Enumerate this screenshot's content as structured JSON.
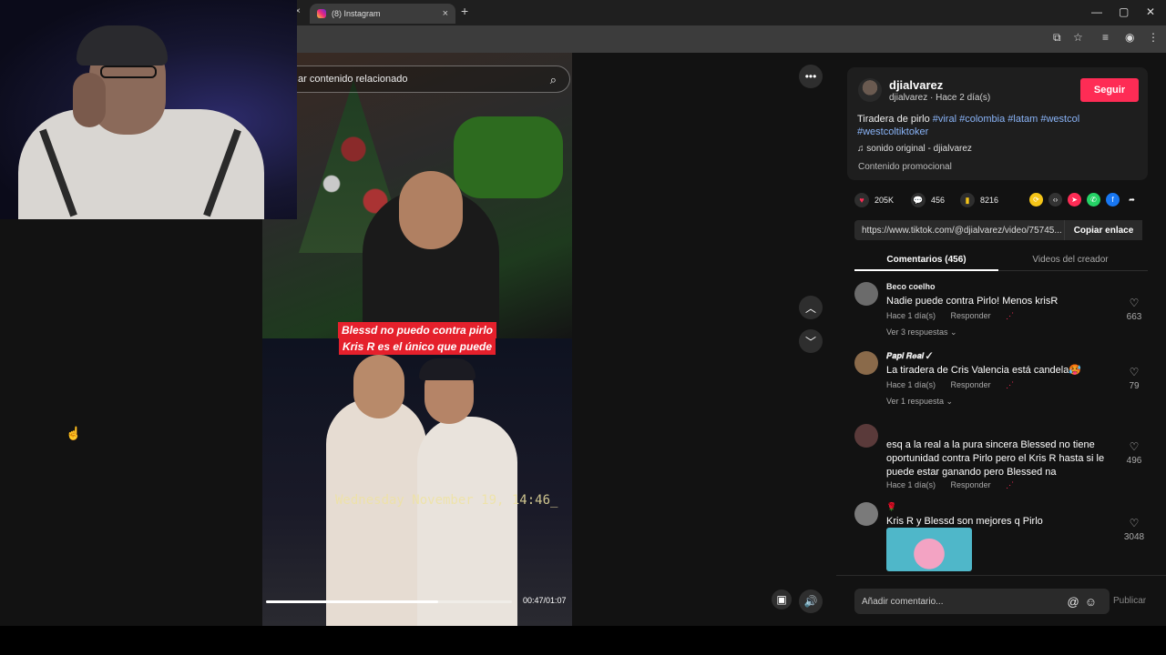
{
  "browser": {
    "tab_title": "(8) Instagram",
    "new_tab": "+",
    "tab_close": "×",
    "prev_tab_close": "×",
    "window_controls": {
      "minimize": "—",
      "maximize": "▢",
      "close": "✕"
    }
  },
  "video": {
    "search_text": "ar contenido relacionado",
    "caption_line1": "Blessd no puedo contra pirlo",
    "caption_line2": "Kris R es el único que puede",
    "timestamp": "Wednesday November 19, 14:46_",
    "time": "00:47/01:07",
    "progress_fraction": 0.7
  },
  "post": {
    "username": "djialvarez",
    "subline": "djialvarez · Hace 2 día(s)",
    "follow_label": "Seguir",
    "description_text": "Tiradera de pirlo",
    "hashtags": "#viral #colombia #latam #westcol #westcoltiktoker",
    "sound": "sonido original - djialvarez",
    "promo": "Contenido promocional",
    "likes": "205K",
    "comments_count": "456",
    "saves": "8216",
    "url": "https://www.tiktok.com/@djialvarez/video/75745...",
    "copy_label": "Copiar enlace"
  },
  "tabs": {
    "comments": "Comentarios (456)",
    "videos": "Videos del creador"
  },
  "comments": [
    {
      "name": "Beco coelho",
      "text": "Nadie puede contra Pirlo! Menos krisR",
      "time": "Hace 1 día(s)",
      "reply": "Responder",
      "replies": "Ver 3 respuestas ⌄",
      "likes": "663"
    },
    {
      "name": "𝑷𝒂𝒑𝒊 𝑹𝒆𝒂𝒍 ✓",
      "text": "La tiradera de Cris Valencia está candela🥵",
      "time": "Hace 1 día(s)",
      "reply": "Responder",
      "replies": "Ver 1 respuesta ⌄",
      "likes": "79"
    },
    {
      "name": "",
      "text": "esq a la real a la pura sincera Blessed no tiene oportunidad contra Pirlo pero el Kris R hasta si le puede estar ganando pero Blessed na",
      "time": "Hace 1 día(s)",
      "reply": "Responder",
      "likes": "496"
    },
    {
      "name": "🌹",
      "text": "Kris R y Blessd son mejores q Pirlo",
      "likes": "3048"
    }
  ],
  "compose": {
    "placeholder": "Añadir comentario...",
    "publish": "Publicar"
  },
  "colors": {
    "follow": "#fe2c55",
    "hashtag": "#8ab4f8",
    "caption_bg": "#e5202c"
  }
}
